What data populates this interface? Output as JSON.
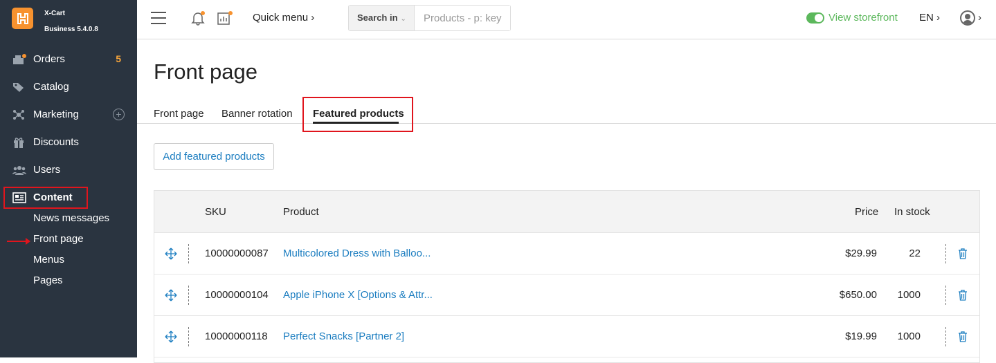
{
  "brand": {
    "name": "X-Cart",
    "edition": "Business 5.4.0.8",
    "logo_icon": "x-cart-logo-icon"
  },
  "sidebar": {
    "items": [
      {
        "label": "Orders",
        "icon": "orders-icon",
        "badge": "5"
      },
      {
        "label": "Catalog",
        "icon": "tags-icon"
      },
      {
        "label": "Marketing",
        "icon": "marketing-icon",
        "action": "+"
      },
      {
        "label": "Discounts",
        "icon": "gift-icon"
      },
      {
        "label": "Users",
        "icon": "users-icon"
      },
      {
        "label": "Content",
        "icon": "content-icon"
      }
    ],
    "subitems": [
      "News messages",
      "Front page",
      "Menus",
      "Pages"
    ]
  },
  "topbar": {
    "quick_menu": "Quick menu ›",
    "search_in": "Search in",
    "search_placeholder": "Products - p: key",
    "storefront": "View storefront",
    "lang": "EN ›",
    "user_chevron": "›"
  },
  "page": {
    "title": "Front page",
    "tabs": [
      "Front page",
      "Banner rotation",
      "Featured products"
    ],
    "active_tab": "Featured products",
    "add_button": "Add featured products"
  },
  "table": {
    "headers": {
      "sku": "SKU",
      "product": "Product",
      "price": "Price",
      "stock": "In stock"
    },
    "rows": [
      {
        "sku": "10000000087",
        "product": "Multicolored Dress with Balloo...",
        "price": "$29.99",
        "stock": "22"
      },
      {
        "sku": "10000000104",
        "product": "Apple iPhone X [Options & Attr...",
        "price": "$650.00",
        "stock": "1000"
      },
      {
        "sku": "10000000118",
        "product": "Perfect Snacks [Partner 2]",
        "price": "$19.99",
        "stock": "1000"
      }
    ]
  },
  "colors": {
    "sidebar_bg": "#2a3440",
    "accent": "#f7922f",
    "link": "#1b7dc0",
    "highlight": "#e0151d",
    "storefront": "#5cb85c"
  }
}
